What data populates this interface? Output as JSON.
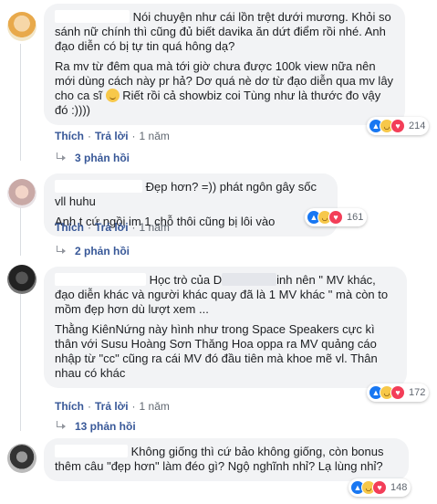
{
  "comments": [
    {
      "lines": [
        "Nói chuyện như cái lồn trệt dưới mương. Khỏi so sánh nữ chính thì cũng đủ biết davika ăn dứt điểm rồi nhé. Anh đạo diễn có bị tự tin quá hông dạ?",
        "Ra mv từ đêm qua mà tới giờ chưa được 100k view nữa nên mới dùng cách này pr hả? Dơ quá nè dơ từ đạo diễn qua mv lây cho ca sĩ",
        "Riết rồi cả showbiz coi Tùng như là thước đo vậy đó :))))"
      ],
      "reaction_count": "214",
      "actions": {
        "like": "Thích",
        "reply": "Trả lời",
        "time": "1 năm"
      },
      "replies": "3 phản hồi"
    },
    {
      "lines": [
        "Đẹp hơn? =)) phát ngôn gây sốc vll huhu",
        "Anh t cứ ngồi im 1 chỗ thôi cũng bị lôi vào"
      ],
      "reaction_count": "161",
      "actions": {
        "like": "Thích",
        "reply": "Trả lời",
        "time": "1 năm"
      },
      "replies": "2 phản hồi"
    },
    {
      "lines": [
        "Học trò của D",
        "inh nên \" MV khác, đạo diễn khác và người khác quay đã là 1 MV khác \" mà còn to mồm đẹp hơn dù lượt xem ...",
        "Thằng KiênNứng này hình như trong Space Speakers cực kì thân với Susu Hoàng Sơn Thăng Hoa oppa ra MV quảng cáo nhập từ \"cc\" cũng ra cái MV đó đầu tiên mà khoe mẽ vl. Thân nhau có khác"
      ],
      "reaction_count": "172",
      "actions": {
        "like": "Thích",
        "reply": "Trả lời",
        "time": "1 năm"
      },
      "replies": "13 phản hồi"
    },
    {
      "lines": [
        "Không giống thì cứ bảo không giống, còn bonus thêm câu \"đẹp hơn\" làm đéo gì? Ngộ nghĩnh nhỉ? Lạ lùng nhỉ?"
      ],
      "reaction_count": "148"
    }
  ]
}
